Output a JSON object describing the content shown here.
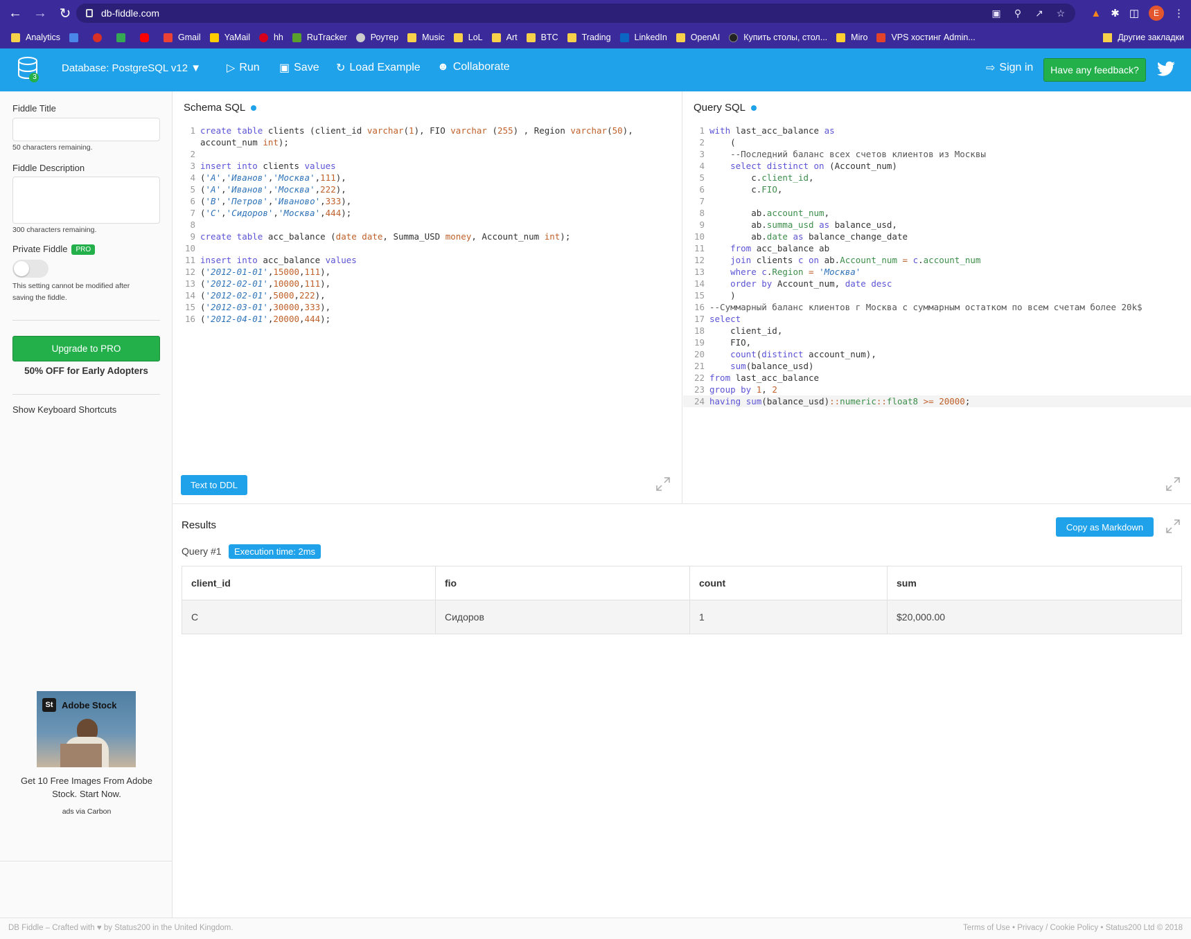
{
  "browser": {
    "url": "db-fiddle.com",
    "profile_initial": "E",
    "bookmarks": [
      "Analytics",
      "Gmail",
      "YaMail",
      "hh",
      "RuTracker",
      "Роутер",
      "Music",
      "LoL",
      "Art",
      "BTC",
      "Trading",
      "LinkedIn",
      "OpenAI",
      "Купить столы, стол...",
      "Miro",
      "VPS хостинг Admin..."
    ],
    "other_bookmarks": "Другие закладки"
  },
  "toolbar": {
    "db_badge": "3",
    "database": "Database: PostgreSQL v12",
    "run": "Run",
    "save": "Save",
    "load_example": "Load Example",
    "collaborate": "Collaborate",
    "sign_in": "Sign in",
    "feedback": "Have any feedback?"
  },
  "sidebar": {
    "title_label": "Fiddle Title",
    "title_value": "",
    "title_remaining": "50 characters remaining.",
    "desc_label": "Fiddle Description",
    "desc_value": "",
    "desc_remaining": "300 characters remaining.",
    "private_label": "Private Fiddle",
    "pro_badge": "PRO",
    "private_note_1": "This setting cannot be modified after",
    "private_note_2": "saving the fiddle.",
    "upgrade_button": "Upgrade to PRO",
    "discount": "50% OFF for Early Adopters",
    "shortcuts": "Show Keyboard Shortcuts",
    "ad_brand": "Adobe Stock",
    "ad_logo": "St",
    "ad_text": "Get 10 Free Images From Adobe Stock. Start Now.",
    "ad_via": "ads via Carbon"
  },
  "schema": {
    "title": "Schema SQL",
    "text_to_ddl": "Text to DDL"
  },
  "query": {
    "title": "Query SQL"
  },
  "results": {
    "label": "Results",
    "copy_markdown": "Copy as Markdown",
    "query_label": "Query #1",
    "exec_time": "Execution time: 2ms",
    "columns": [
      "client_id",
      "fio",
      "count",
      "sum"
    ],
    "rows": [
      [
        "C",
        "Сидоров",
        "1",
        "$20,000.00"
      ]
    ]
  },
  "footer": {
    "left": "DB Fiddle – Crafted with ♥ by Status200 in the United Kingdom.",
    "right": "Terms of Use • Privacy / Cookie Policy • Status200 Ltd © 2018"
  },
  "colors": {
    "brand": "#1fa2ea",
    "green": "#23b04b",
    "browser": "#3a2a9a"
  }
}
